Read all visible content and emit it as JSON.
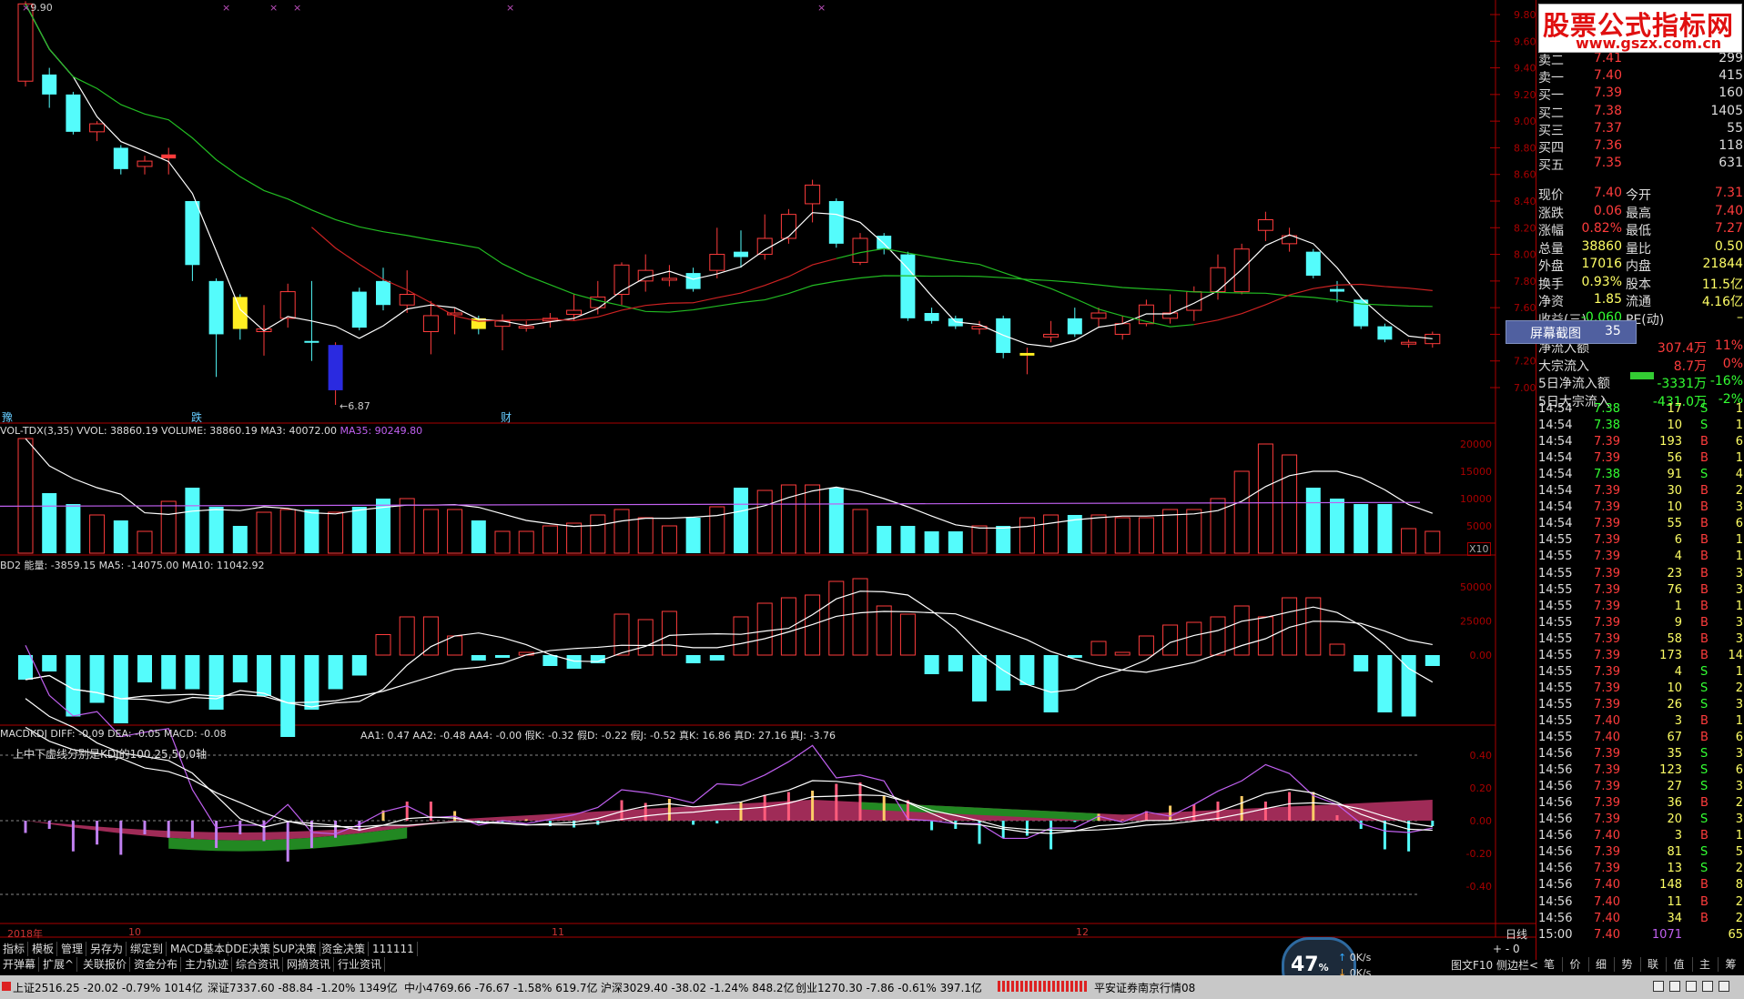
{
  "colors": {
    "up": "#ff3c3c",
    "down": "#54fcfc",
    "ma_white": "#ffffff",
    "ma_green": "#22bb22",
    "ma_red": "#cc2222",
    "purple": "#c060f0",
    "yellow": "#ffee22",
    "magenta": "#b03060",
    "green": "#228822",
    "axis": "#aa0000"
  },
  "top_marks": {
    "price_label": "9.90",
    "x_marks": [
      "×",
      "×",
      "×",
      "×",
      "×"
    ]
  },
  "main_chart": {
    "y_axis": [
      "9.80",
      "9.60",
      "9.40",
      "9.20",
      "9.00",
      "8.80",
      "8.60",
      "8.40",
      "8.20",
      "8.00",
      "7.80",
      "7.60",
      "7.40",
      "7.20",
      "7.00"
    ],
    "low_label": "6.87",
    "bottom_tags": [
      "豫",
      "跌",
      "财"
    ],
    "candles": [
      {
        "o": 9.3,
        "c": 9.88,
        "h": 9.9,
        "l": 9.26
      },
      {
        "o": 9.35,
        "c": 9.2,
        "h": 9.4,
        "l": 9.1
      },
      {
        "o": 9.2,
        "c": 8.92,
        "h": 9.22,
        "l": 8.9
      },
      {
        "o": 8.92,
        "c": 8.98,
        "h": 9.0,
        "l": 8.85
      },
      {
        "o": 8.8,
        "c": 8.64,
        "h": 8.82,
        "l": 8.6
      },
      {
        "o": 8.66,
        "c": 8.7,
        "h": 8.74,
        "l": 8.6
      },
      {
        "o": 8.72,
        "c": 8.75,
        "h": 8.8,
        "l": 8.6
      },
      {
        "o": 8.4,
        "c": 7.92,
        "h": 8.4,
        "l": 7.8
      },
      {
        "o": 7.8,
        "c": 7.4,
        "h": 7.82,
        "l": 7.08
      },
      {
        "o": 7.68,
        "c": 7.44,
        "h": 7.7,
        "l": 7.36
      },
      {
        "o": 7.42,
        "c": 7.44,
        "h": 7.62,
        "l": 7.24
      },
      {
        "o": 7.52,
        "c": 7.72,
        "h": 7.78,
        "l": 7.45
      },
      {
        "o": 7.35,
        "c": 7.34,
        "h": 7.8,
        "l": 7.2
      },
      {
        "o": 6.98,
        "c": 7.32,
        "h": 7.34,
        "l": 6.87
      },
      {
        "o": 7.72,
        "c": 7.45,
        "h": 7.75,
        "l": 7.43
      },
      {
        "o": 7.8,
        "c": 7.62,
        "h": 7.9,
        "l": 7.58
      },
      {
        "o": 7.62,
        "c": 7.7,
        "h": 7.88,
        "l": 7.56
      },
      {
        "o": 7.42,
        "c": 7.54,
        "h": 7.65,
        "l": 7.25
      },
      {
        "o": 7.55,
        "c": 7.56,
        "h": 7.6,
        "l": 7.4
      },
      {
        "o": 7.52,
        "c": 7.44,
        "h": 7.54,
        "l": 7.4
      },
      {
        "o": 7.46,
        "c": 7.5,
        "h": 7.55,
        "l": 7.28
      },
      {
        "o": 7.45,
        "c": 7.46,
        "h": 7.5,
        "l": 7.42
      },
      {
        "o": 7.5,
        "c": 7.52,
        "h": 7.56,
        "l": 7.45
      },
      {
        "o": 7.55,
        "c": 7.58,
        "h": 7.7,
        "l": 7.5
      },
      {
        "o": 7.6,
        "c": 7.68,
        "h": 7.8,
        "l": 7.55
      },
      {
        "o": 7.7,
        "c": 7.92,
        "h": 7.94,
        "l": 7.62
      },
      {
        "o": 7.8,
        "c": 7.88,
        "h": 8.0,
        "l": 7.72
      },
      {
        "o": 7.82,
        "c": 7.82,
        "h": 7.92,
        "l": 7.76
      },
      {
        "o": 7.86,
        "c": 7.74,
        "h": 7.9,
        "l": 7.72
      },
      {
        "o": 7.88,
        "c": 8.0,
        "h": 8.2,
        "l": 7.82
      },
      {
        "o": 8.02,
        "c": 7.98,
        "h": 8.18,
        "l": 7.9
      },
      {
        "o": 8.0,
        "c": 8.12,
        "h": 8.3,
        "l": 7.96
      },
      {
        "o": 8.12,
        "c": 8.3,
        "h": 8.34,
        "l": 8.08
      },
      {
        "o": 8.38,
        "c": 8.52,
        "h": 8.56,
        "l": 8.24
      },
      {
        "o": 8.4,
        "c": 8.08,
        "h": 8.42,
        "l": 8.05
      },
      {
        "o": 7.94,
        "c": 8.12,
        "h": 8.16,
        "l": 7.92
      },
      {
        "o": 8.14,
        "c": 8.04,
        "h": 8.16,
        "l": 8.0
      },
      {
        "o": 8.0,
        "c": 7.52,
        "h": 8.02,
        "l": 7.5
      },
      {
        "o": 7.56,
        "c": 7.5,
        "h": 7.6,
        "l": 7.48
      },
      {
        "o": 7.52,
        "c": 7.46,
        "h": 7.54,
        "l": 7.44
      },
      {
        "o": 7.44,
        "c": 7.46,
        "h": 7.5,
        "l": 7.4
      },
      {
        "o": 7.52,
        "c": 7.26,
        "h": 7.54,
        "l": 7.22
      },
      {
        "o": 7.24,
        "c": 7.26,
        "h": 7.3,
        "l": 7.1
      },
      {
        "o": 7.38,
        "c": 7.4,
        "h": 7.5,
        "l": 7.34
      },
      {
        "o": 7.52,
        "c": 7.4,
        "h": 7.6,
        "l": 7.38
      },
      {
        "o": 7.52,
        "c": 7.56,
        "h": 7.6,
        "l": 7.45
      },
      {
        "o": 7.4,
        "c": 7.48,
        "h": 7.54,
        "l": 7.36
      },
      {
        "o": 7.48,
        "c": 7.62,
        "h": 7.66,
        "l": 7.46
      },
      {
        "o": 7.52,
        "c": 7.56,
        "h": 7.7,
        "l": 7.48
      },
      {
        "o": 7.58,
        "c": 7.72,
        "h": 7.76,
        "l": 7.5
      },
      {
        "o": 7.72,
        "c": 7.9,
        "h": 8.0,
        "l": 7.66
      },
      {
        "o": 7.72,
        "c": 8.04,
        "h": 8.08,
        "l": 7.7
      },
      {
        "o": 8.18,
        "c": 8.26,
        "h": 8.32,
        "l": 8.1
      },
      {
        "o": 8.08,
        "c": 8.14,
        "h": 8.2,
        "l": 8.02
      },
      {
        "o": 8.02,
        "c": 7.84,
        "h": 8.04,
        "l": 7.82
      },
      {
        "o": 7.74,
        "c": 7.72,
        "h": 7.8,
        "l": 7.64
      },
      {
        "o": 7.66,
        "c": 7.46,
        "h": 7.68,
        "l": 7.44
      },
      {
        "o": 7.46,
        "c": 7.36,
        "h": 7.48,
        "l": 7.34
      },
      {
        "o": 7.33,
        "c": 7.34,
        "h": 7.36,
        "l": 7.3
      },
      {
        "o": 7.33,
        "c": 7.4,
        "h": 7.42,
        "l": 7.3
      }
    ],
    "special_colors": {
      "9": "yellow",
      "13": "blue",
      "19": "yellow",
      "42": "yellow",
      "6": "white"
    }
  },
  "vol_panel": {
    "title": "VOL-TDX(3,35) VVOL: 38860.19  VOLUME: 38860.19  MA3: 40072.00",
    "ma35": "MA35: 90249.80",
    "y_axis": [
      "20000",
      "15000",
      "10000",
      "5000"
    ],
    "x10": "X10",
    "values": [
      21000,
      11000,
      9000,
      7000,
      6000,
      4000,
      9500,
      12000,
      8500,
      5000,
      7500,
      8000,
      8000,
      7500,
      8500,
      10000,
      10000,
      8000,
      8000,
      6000,
      4000,
      4000,
      5000,
      5500,
      7000,
      8000,
      6500,
      5000,
      6500,
      8500,
      12000,
      11500,
      12500,
      12500,
      12000,
      8000,
      5000,
      5000,
      4000,
      4000,
      5000,
      5000,
      6500,
      7000,
      7000,
      7000,
      6500,
      6500,
      8000,
      8000,
      10000,
      15000,
      20000,
      18000,
      12000,
      10000,
      9000,
      9000,
      4500,
      4000
    ]
  },
  "energy_panel": {
    "title": "BD2 能量: -3859.15  MA5: -14075.00  MA10: 11042.92",
    "y_axis": [
      "50000",
      "25000",
      "0.00"
    ],
    "values": [
      -18000,
      -12000,
      -45000,
      -35000,
      -50000,
      -20000,
      -25000,
      -25000,
      -40000,
      -20000,
      -30000,
      -60000,
      -40000,
      -25000,
      -15000,
      15000,
      28000,
      28000,
      14000,
      -4000,
      -2000,
      2000,
      -8000,
      -10000,
      -6000,
      30000,
      26000,
      32000,
      -6000,
      -4000,
      28000,
      38000,
      42000,
      44000,
      54000,
      56000,
      36000,
      30000,
      -14000,
      -12000,
      -34000,
      -26000,
      -22000,
      -42000,
      -2000,
      10000,
      2000,
      14000,
      22000,
      24000,
      28000,
      36000,
      28000,
      42000,
      42000,
      8000,
      -12000,
      -42000,
      -45000,
      -8000
    ]
  },
  "macd_panel": {
    "title": "MACDKDJ  DIFF: -0.09  DEA: -0.05  MACD: -0.08",
    "kdj_text": "AA1: 0.47  AA2: -0.48  AA4: -0.00  假K: -0.32  假D: -0.22  假J: -0.52  真K: 16.86  真D: 27.16  真J: -3.76",
    "note": "上中下虚线分别是KDJ的100,25,50,0轴",
    "y_axis": [
      "0.40",
      "0.20",
      "0.00",
      "-0.20",
      "-0.40"
    ]
  },
  "x_axis": {
    "labels": [
      "2018年",
      "10",
      "11",
      "12"
    ],
    "right": "日线"
  },
  "tabs_row1": [
    "指标",
    "模板",
    "管理",
    "另存为",
    "绑定到",
    "MACD基本",
    "DDE决策",
    "SUP决策",
    "资金决策",
    "111111"
  ],
  "tabs_row2": [
    "开弹幕",
    "扩展^",
    "关联报价",
    "资金分布",
    "主力轨迹",
    "综合资讯",
    "网摘资讯",
    "行业资讯"
  ],
  "speed_widget": {
    "pct": "47",
    "unit": "%",
    "up": "0K/s",
    "down": "0K/s"
  },
  "right_tools": [
    "图文F10",
    "侧边栏<"
  ],
  "quote_tabs": [
    "笔",
    "价",
    "细",
    "势",
    "联",
    "值",
    "主",
    "筹"
  ],
  "watermark": {
    "title": "股票公式指标网",
    "url": "www.gszx.com.cn"
  },
  "popup": {
    "label": "屏幕截图",
    "value": "35"
  },
  "order_book": [
    {
      "label": "卖二",
      "price": "7.41",
      "vol": "299"
    },
    {
      "label": "卖一",
      "price": "7.40",
      "vol": "415"
    },
    {
      "label": "买一",
      "price": "7.39",
      "vol": "160"
    },
    {
      "label": "买二",
      "price": "7.38",
      "vol": "1405"
    },
    {
      "label": "买三",
      "price": "7.37",
      "vol": "55"
    },
    {
      "label": "买四",
      "price": "7.36",
      "vol": "118"
    },
    {
      "label": "买五",
      "price": "7.35",
      "vol": "631"
    }
  ],
  "stats": [
    {
      "l1": "现价",
      "v1": "7.40",
      "l2": "今开",
      "v2": "7.31"
    },
    {
      "l1": "涨跌",
      "v1": "0.06",
      "l2": "最高",
      "v2": "7.40"
    },
    {
      "l1": "涨幅",
      "v1": "0.82%",
      "l2": "最低",
      "v2": "7.27"
    },
    {
      "l1": "总量",
      "v1": "38860",
      "l2": "量比",
      "v2": "0.50"
    },
    {
      "l1": "外盘",
      "v1": "17016",
      "l2": "内盘",
      "v2": "21844"
    },
    {
      "l1": "换手",
      "v1": "0.93%",
      "l2": "股本",
      "v2": "11.5亿"
    },
    {
      "l1": "净资",
      "v1": "1.85",
      "l2": "流通",
      "v2": "4.16亿"
    },
    {
      "l1": "收益(三)",
      "v1": "-0.060",
      "l2": "PE(动)",
      "v2": "–"
    }
  ],
  "flows": [
    {
      "label": "净流入额",
      "value": "307.4万",
      "pct": "11%"
    },
    {
      "label": "大宗流入",
      "value": "8.7万",
      "pct": "0%"
    },
    {
      "label": "5日净流入额",
      "value": "-3331万",
      "pct": "-16%"
    },
    {
      "label": "5日大宗流入",
      "value": "-431.0万",
      "pct": "-2%"
    }
  ],
  "ticks": [
    [
      "14:54",
      "7.38",
      "17",
      "S",
      "1"
    ],
    [
      "14:54",
      "7.38",
      "10",
      "S",
      "1"
    ],
    [
      "14:54",
      "7.39",
      "193",
      "B",
      "6"
    ],
    [
      "14:54",
      "7.39",
      "56",
      "B",
      "1"
    ],
    [
      "14:54",
      "7.38",
      "91",
      "S",
      "4"
    ],
    [
      "14:54",
      "7.39",
      "30",
      "B",
      "2"
    ],
    [
      "14:54",
      "7.39",
      "10",
      "B",
      "3"
    ],
    [
      "14:54",
      "7.39",
      "55",
      "B",
      "6"
    ],
    [
      "14:55",
      "7.39",
      "6",
      "B",
      "1"
    ],
    [
      "14:55",
      "7.39",
      "4",
      "B",
      "1"
    ],
    [
      "14:55",
      "7.39",
      "23",
      "B",
      "3"
    ],
    [
      "14:55",
      "7.39",
      "76",
      "B",
      "3"
    ],
    [
      "14:55",
      "7.39",
      "1",
      "B",
      "1"
    ],
    [
      "14:55",
      "7.39",
      "9",
      "B",
      "3"
    ],
    [
      "14:55",
      "7.39",
      "58",
      "B",
      "3"
    ],
    [
      "14:55",
      "7.39",
      "173",
      "B",
      "14"
    ],
    [
      "14:55",
      "7.39",
      "4",
      "S",
      "1"
    ],
    [
      "14:55",
      "7.39",
      "10",
      "S",
      "2"
    ],
    [
      "14:55",
      "7.39",
      "26",
      "S",
      "3"
    ],
    [
      "14:55",
      "7.40",
      "3",
      "B",
      "1"
    ],
    [
      "14:55",
      "7.40",
      "67",
      "B",
      "6"
    ],
    [
      "14:56",
      "7.39",
      "35",
      "S",
      "3"
    ],
    [
      "14:56",
      "7.39",
      "123",
      "S",
      "6"
    ],
    [
      "14:56",
      "7.39",
      "27",
      "S",
      "3"
    ],
    [
      "14:56",
      "7.39",
      "36",
      "B",
      "2"
    ],
    [
      "14:56",
      "7.39",
      "20",
      "S",
      "3"
    ],
    [
      "14:56",
      "7.40",
      "3",
      "B",
      "1"
    ],
    [
      "14:56",
      "7.39",
      "81",
      "S",
      "5"
    ],
    [
      "14:56",
      "7.39",
      "13",
      "S",
      "2"
    ],
    [
      "14:56",
      "7.40",
      "148",
      "B",
      "8"
    ],
    [
      "14:56",
      "7.40",
      "11",
      "B",
      "2"
    ],
    [
      "14:56",
      "7.40",
      "34",
      "B",
      "2"
    ],
    [
      "15:00",
      "7.40",
      "1071",
      "",
      "65"
    ]
  ],
  "status": {
    "sh": "上证2516.25  -20.02  -0.79%  1014亿",
    "sz": "深证7337.60  -88.84  -1.20%  1349亿",
    "zx": "中小4769.66  -76.67  -1.58%  619.7亿",
    "hs": "沪深3029.40  -38.02  -1.24%  848.2亿",
    "cy": "创业1270.30  -7.86  -0.61%  397.1亿",
    "broker": "平安证券南京行情08"
  }
}
